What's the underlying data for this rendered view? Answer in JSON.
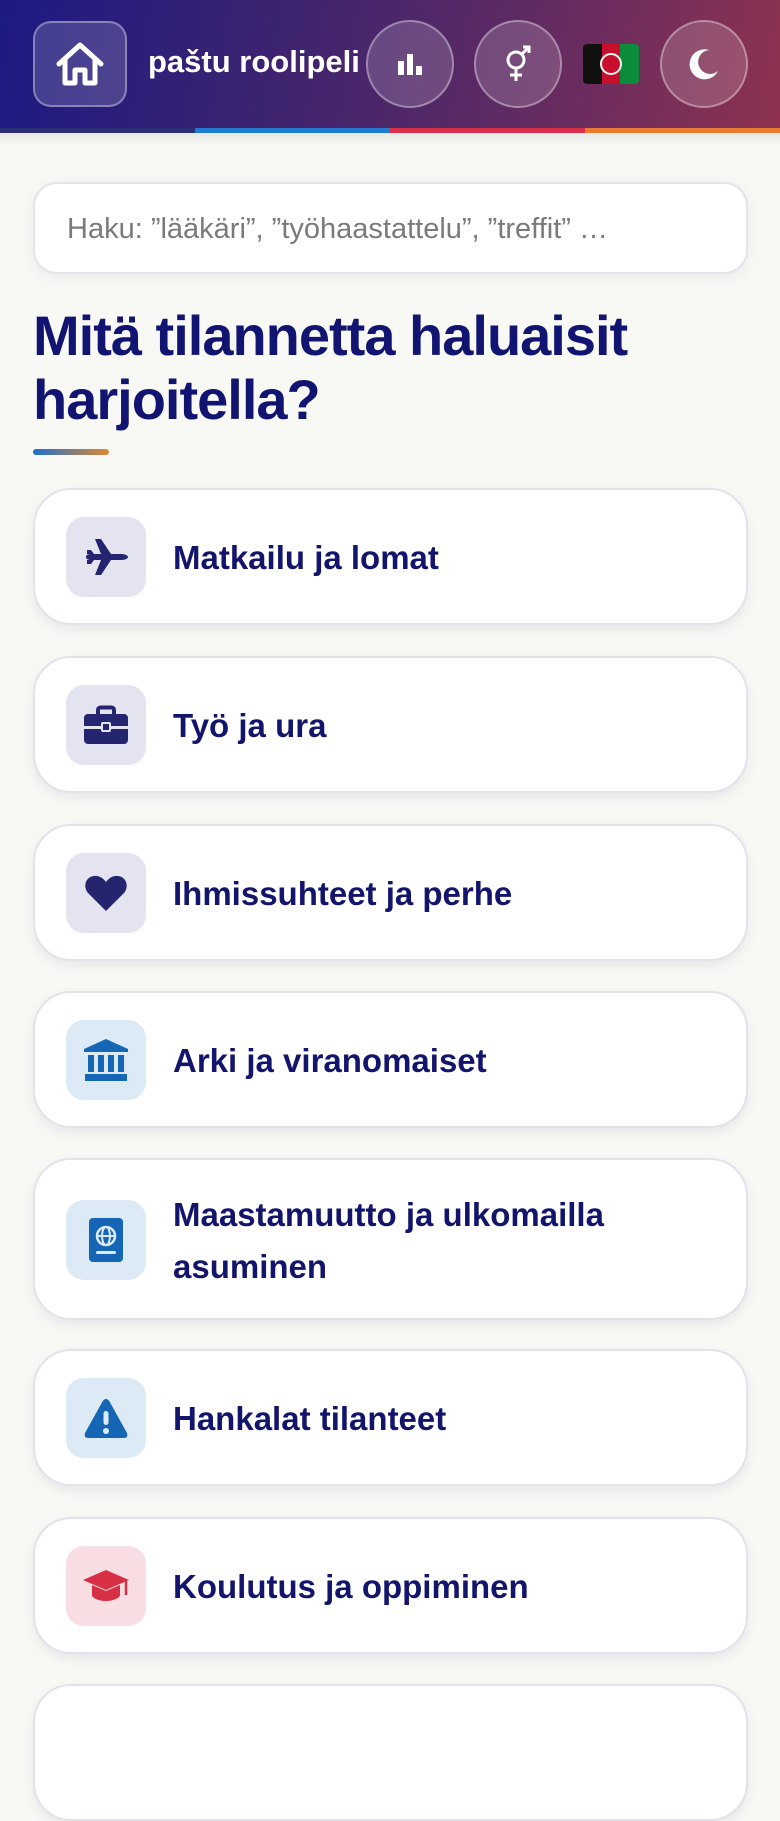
{
  "header": {
    "title": "paštu roolipeli",
    "home_icon": "home-icon",
    "stats_icon": "bar-chart-icon",
    "gender_icon": "gender-icon",
    "language_flag": "afghanistan-flag",
    "theme_icon": "moon-icon"
  },
  "search": {
    "placeholder": "Haku: ”lääkäri”, ”työhaastattelu”, ”treffit” …"
  },
  "main": {
    "heading": "Mitä tilannetta haluaisit harjoitella?"
  },
  "categories": [
    {
      "label": "Matkailu ja lomat",
      "icon": "plane-icon"
    },
    {
      "label": "Työ ja ura",
      "icon": "briefcase-icon"
    },
    {
      "label": "Ihmissuhteet ja perhe",
      "icon": "heart-icon"
    },
    {
      "label": "Arki ja viranomaiset",
      "icon": "government-building-icon"
    },
    {
      "label": "Maastamuutto ja ulkomailla asuminen",
      "icon": "passport-icon"
    },
    {
      "label": "Hankalat tilanteet",
      "icon": "warning-icon"
    },
    {
      "label": "Koulutus ja oppiminen",
      "icon": "graduation-cap-icon"
    }
  ],
  "colors": {
    "heading": "#111470",
    "indigo_tile": "#e4e4f0",
    "blue_tile": "#dceaf6",
    "red_tile": "#f8dde2"
  }
}
